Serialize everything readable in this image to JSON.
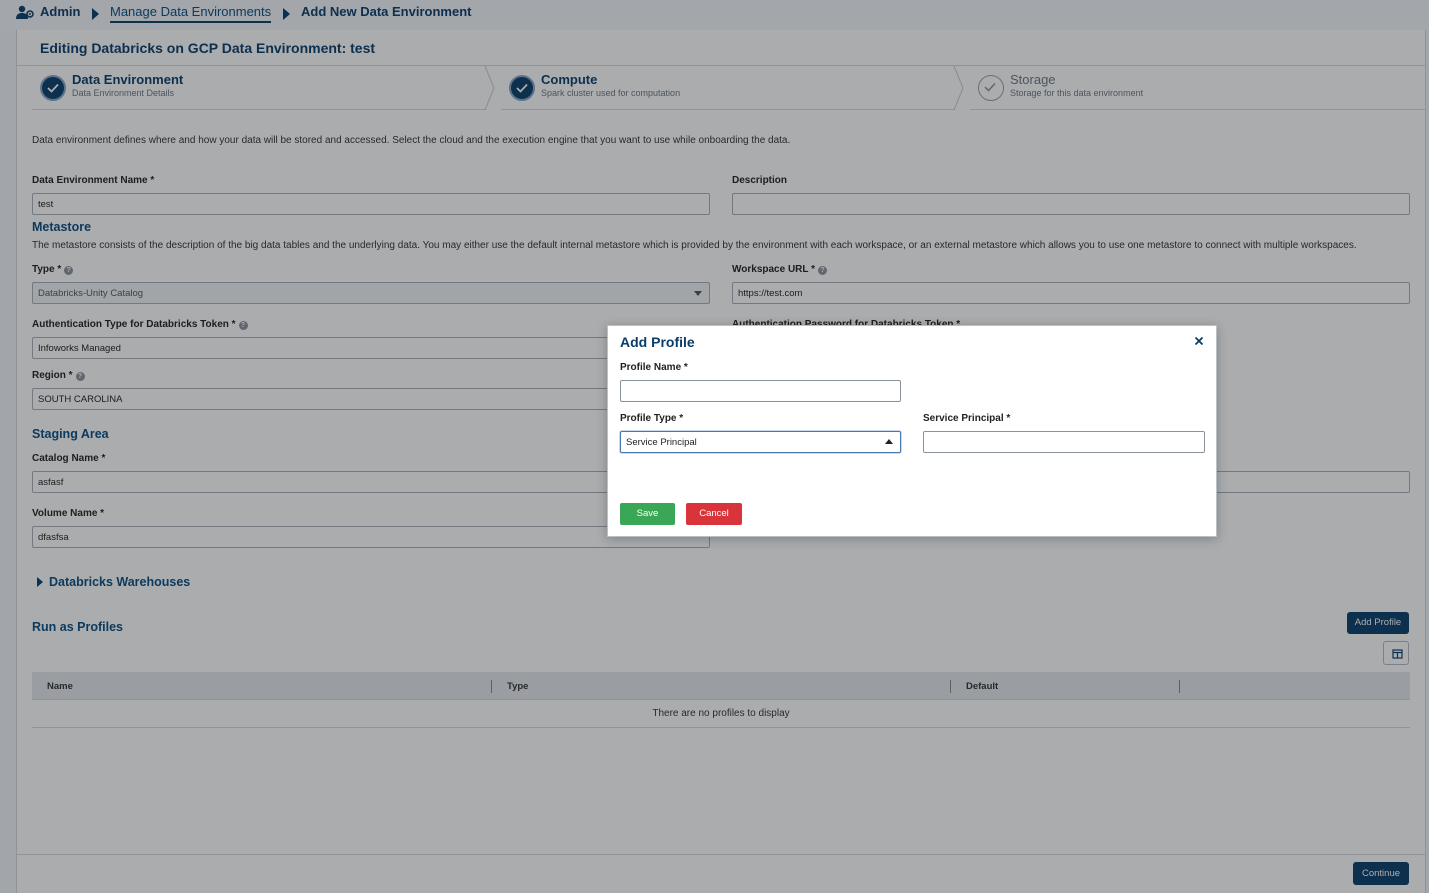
{
  "breadcrumb": {
    "admin": "Admin",
    "manage": "Manage Data Environments",
    "current": "Add New Data Environment"
  },
  "page_title": "Editing Databricks on GCP Data Environment: test",
  "steps": [
    {
      "title": "Data Environment",
      "subtitle": "Data Environment Details",
      "state": "done"
    },
    {
      "title": "Compute",
      "subtitle": "Spark cluster used for computation",
      "state": "done"
    },
    {
      "title": "Storage",
      "subtitle": "Storage for this data environment",
      "state": "todo"
    }
  ],
  "intro": "Data environment defines where and how your data will be stored and accessed. Select the cloud and the execution engine that you want to use while onboarding the data.",
  "form": {
    "name_label": "Data Environment Name *",
    "name_value": "test",
    "description_label": "Description",
    "description_value": "",
    "metastore_title": "Metastore",
    "metastore_desc": "The metastore consists of the description of the big data tables and the underlying data. You may either use the default internal metastore which is provided by the environment with each workspace, or an external metastore which allows you to use one metastore to connect with multiple workspaces.",
    "type_label": "Type *",
    "type_value": "Databricks-Unity Catalog",
    "workspace_label": "Workspace URL *",
    "workspace_value": "https://test.com",
    "auth_type_label": "Authentication Type for Databricks Token *",
    "auth_type_value": "Infoworks Managed",
    "auth_password_label": "Authentication Password for Databricks Token *",
    "region_label": "Region *",
    "region_value": "SOUTH CAROLINA",
    "staging_title": "Staging Area",
    "catalog_label": "Catalog Name *",
    "catalog_value": "asfasf",
    "volume_label": "Volume Name *",
    "volume_value": "dfasfsa",
    "warehouses_title": "Databricks Warehouses",
    "profiles_title": "Run as Profiles",
    "add_profile_button": "Add Profile",
    "table_headers": [
      "Name",
      "Type",
      "Default"
    ],
    "empty_text": "There are no profiles to display",
    "continue_button": "Continue"
  },
  "modal": {
    "title": "Add Profile",
    "profile_name_label": "Profile Name *",
    "profile_name_value": "",
    "profile_type_label": "Profile Type *",
    "profile_type_value": "Service Principal",
    "service_principal_label": "Service Principal *",
    "service_principal_value": "",
    "save_button": "Save",
    "cancel_button": "Cancel"
  },
  "colors": {
    "brand": "#0a3d6b",
    "save": "#3aa757",
    "cancel": "#d9343a"
  }
}
